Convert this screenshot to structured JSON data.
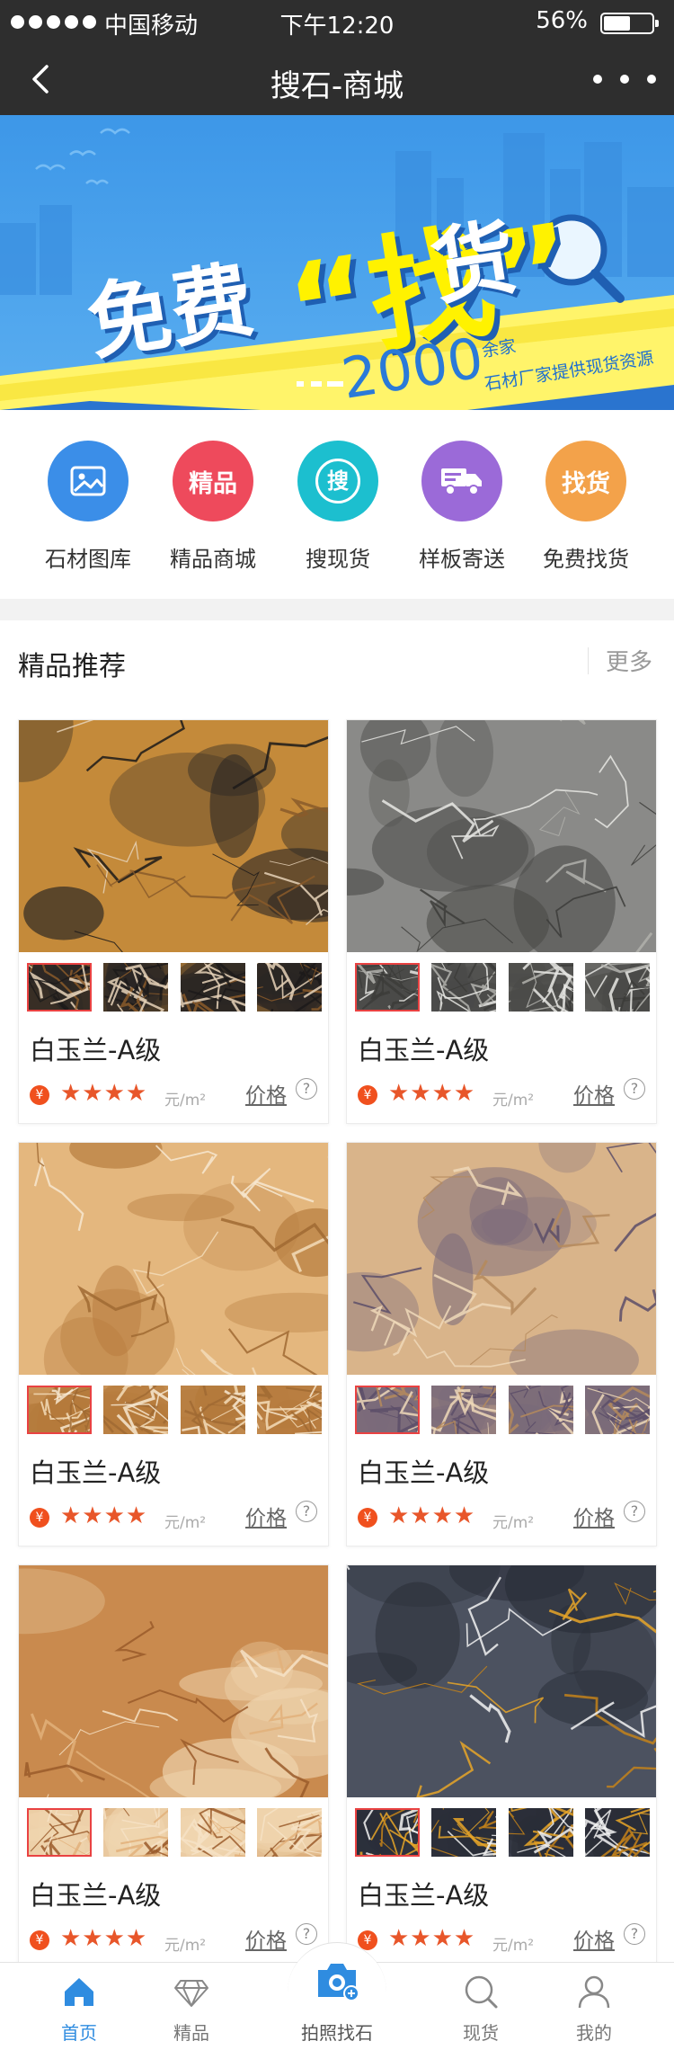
{
  "status_bar": {
    "carrier": "中国移动",
    "time": "下午12:20",
    "battery_pct": "56%",
    "battery_level": 0.56
  },
  "nav": {
    "title": "搜石-商城",
    "back_icon": "chevron-left-icon",
    "more_icon": "more-dots-icon"
  },
  "banner": {
    "headline_left": "免费",
    "headline_main": "“找”",
    "headline_right": "货",
    "number": "2000",
    "sub_line1": "余家",
    "sub_line2": "石材厂家提供现货资源",
    "colors": {
      "background": "#4a9fec",
      "accent": "#fff200"
    }
  },
  "quick_entries": [
    {
      "label": "石材图库",
      "icon": "image-icon",
      "color": "#3b8ee8"
    },
    {
      "label": "精品商城",
      "icon_text": "精品",
      "color": "#ee4a5c"
    },
    {
      "label": "搜现货",
      "icon_text": "搜",
      "color": "#1cbfcf"
    },
    {
      "label": "样板寄送",
      "icon": "truck-icon",
      "color": "#9b6ad8"
    },
    {
      "label": "免费找货",
      "icon_text": "找货",
      "color": "#f3a24a"
    }
  ],
  "section": {
    "title": "精品推荐",
    "more": "更多"
  },
  "products": [
    {
      "title": "白玉兰-A级",
      "rating": "★★★★",
      "unit": "元/m²",
      "price_label": "价格",
      "help": "?"
    },
    {
      "title": "白玉兰-A级",
      "rating": "★★★★",
      "unit": "元/m²",
      "price_label": "价格",
      "help": "?"
    },
    {
      "title": "白玉兰-A级",
      "rating": "★★★★",
      "unit": "元/m²",
      "price_label": "价格",
      "help": "?"
    },
    {
      "title": "白玉兰-A级",
      "rating": "★★★★",
      "unit": "元/m²",
      "price_label": "价格",
      "help": "?"
    },
    {
      "title": "白玉兰-A级",
      "rating": "★★★★",
      "unit": "元/m²",
      "price_label": "价格",
      "help": "?"
    },
    {
      "title": "白玉兰-A级",
      "rating": "★★★★",
      "unit": "元/m²",
      "price_label": "价格",
      "help": "?"
    }
  ],
  "currency_symbol": "¥",
  "tabbar": [
    {
      "label": "首页",
      "icon": "home-icon",
      "active": true
    },
    {
      "label": "精品",
      "icon": "diamond-icon",
      "active": false
    },
    {
      "label": "拍照找石",
      "icon": "camera-icon",
      "active": false
    },
    {
      "label": "现货",
      "icon": "search-icon",
      "active": false
    },
    {
      "label": "我的",
      "icon": "user-icon",
      "active": false
    }
  ],
  "colors": {
    "active_tab": "#2f8ce0",
    "rating": "#e8562a",
    "topbar": "#2e2e2e"
  }
}
